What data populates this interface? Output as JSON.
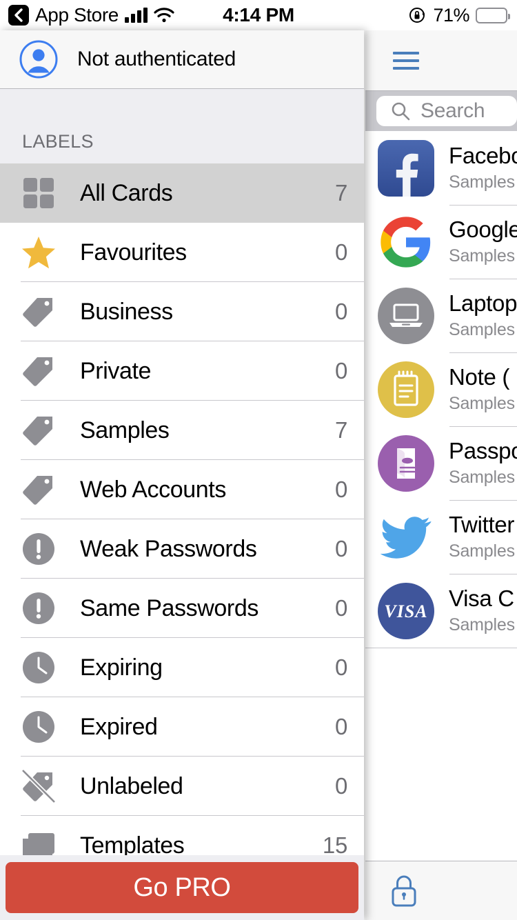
{
  "status_bar": {
    "back_label": "App Store",
    "back_icon": "chevron-left-icon",
    "signal_icon": "cellular-signal-icon",
    "wifi_icon": "wifi-icon",
    "time": "4:14 PM",
    "rotation_lock_icon": "rotation-lock-icon",
    "battery_percent": "71%",
    "battery_level": 71,
    "battery_icon": "battery-icon"
  },
  "drawer": {
    "account": {
      "avatar_icon": "user-avatar-icon",
      "status_text": "Not authenticated"
    },
    "section_header": "LABELS",
    "labels": [
      {
        "icon": "grid-icon",
        "name": "All Cards",
        "count": "7",
        "selected": true
      },
      {
        "icon": "star-icon",
        "name": "Favourites",
        "count": "0",
        "selected": false
      },
      {
        "icon": "tag-icon",
        "name": "Business",
        "count": "0",
        "selected": false
      },
      {
        "icon": "tag-icon",
        "name": "Private",
        "count": "0",
        "selected": false
      },
      {
        "icon": "tag-icon",
        "name": "Samples",
        "count": "7",
        "selected": false
      },
      {
        "icon": "tag-icon",
        "name": "Web Accounts",
        "count": "0",
        "selected": false
      },
      {
        "icon": "exclamation-icon",
        "name": "Weak Passwords",
        "count": "0",
        "selected": false
      },
      {
        "icon": "exclamation-icon",
        "name": "Same Passwords",
        "count": "0",
        "selected": false
      },
      {
        "icon": "clock-icon",
        "name": "Expiring",
        "count": "0",
        "selected": false
      },
      {
        "icon": "clock-icon",
        "name": "Expired",
        "count": "0",
        "selected": false
      },
      {
        "icon": "tag-slash-icon",
        "name": "Unlabeled",
        "count": "0",
        "selected": false
      },
      {
        "icon": "folders-icon",
        "name": "Templates",
        "count": "15",
        "selected": false
      }
    ],
    "go_pro_label": "Go PRO"
  },
  "right_panel": {
    "menu_icon": "hamburger-menu-icon",
    "search": {
      "icon": "search-icon",
      "placeholder": "Search",
      "value": ""
    },
    "cards": [
      {
        "icon": "facebook-icon",
        "title": "Facebo",
        "subtitle": "Samples"
      },
      {
        "icon": "google-icon",
        "title": "Google",
        "subtitle": "Samples"
      },
      {
        "icon": "laptop-icon",
        "title": "Laptop",
        "subtitle": "Samples"
      },
      {
        "icon": "note-icon",
        "title": "Note (",
        "subtitle": "Samples"
      },
      {
        "icon": "passport-icon",
        "title": "Passpo",
        "subtitle": "Samples"
      },
      {
        "icon": "twitter-icon",
        "title": "Twitter",
        "subtitle": "Samples"
      },
      {
        "icon": "visa-icon",
        "title": "Visa C",
        "subtitle": "Samples"
      }
    ],
    "toolbar": {
      "lock_icon": "lock-icon"
    }
  },
  "colors": {
    "accent_blue": "#4a7ebb",
    "go_pro_red": "#d24b3c",
    "selected_row": "#d2d2d2",
    "star_yellow": "#f0b93c",
    "note_yellow": "#dfc049",
    "passport_purple": "#9a5fae",
    "twitter_blue": "#4fa5e8",
    "visa_navy": "#3f559b",
    "laptop_gray": "#8e8e93"
  }
}
